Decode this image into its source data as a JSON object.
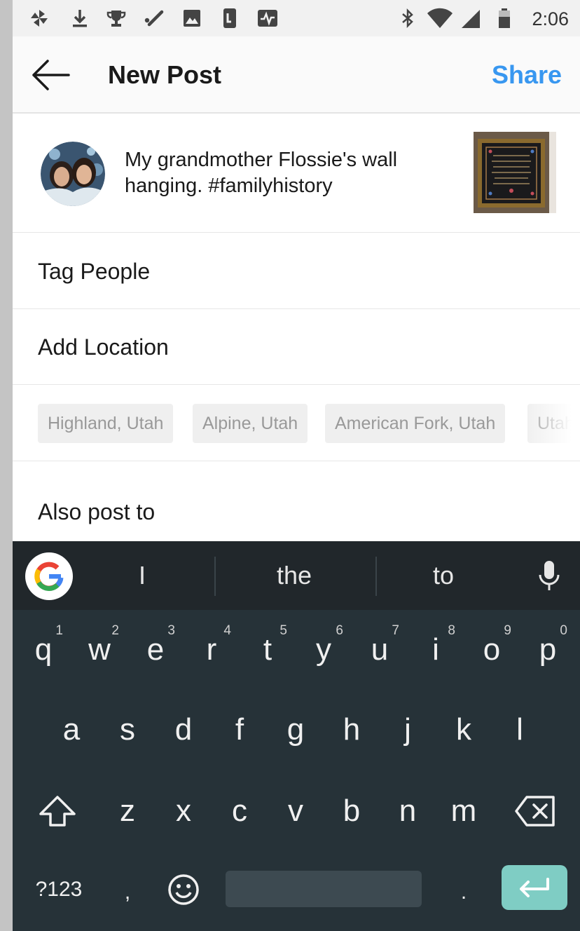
{
  "status_bar": {
    "time": "2:06",
    "left_icons": [
      "pinwheel-icon",
      "download-icon",
      "trophy-icon",
      "pen-icon",
      "image-icon",
      "phone-icon",
      "activity-icon"
    ],
    "right_icons": [
      "bluetooth-icon",
      "wifi-icon",
      "signal-icon",
      "battery-icon"
    ]
  },
  "toolbar": {
    "title": "New Post",
    "share_label": "Share",
    "back_icon": "arrow-left-icon"
  },
  "post": {
    "caption": "My grandmother Flossie's wall hanging. #familyhistory"
  },
  "options": {
    "tag_people": "Tag People",
    "add_location": "Add Location",
    "also_post_to": "Also post to"
  },
  "location_suggestions": [
    "Highland, Utah",
    "Alpine, Utah",
    "American Fork, Utah",
    "Utah"
  ],
  "keyboard": {
    "suggestions": [
      "I",
      "the",
      "to"
    ],
    "row1": [
      {
        "key": "q",
        "hint": "1"
      },
      {
        "key": "w",
        "hint": "2"
      },
      {
        "key": "e",
        "hint": "3"
      },
      {
        "key": "r",
        "hint": "4"
      },
      {
        "key": "t",
        "hint": "5"
      },
      {
        "key": "y",
        "hint": "6"
      },
      {
        "key": "u",
        "hint": "7"
      },
      {
        "key": "i",
        "hint": "8"
      },
      {
        "key": "o",
        "hint": "9"
      },
      {
        "key": "p",
        "hint": "0"
      }
    ],
    "row2": [
      "a",
      "s",
      "d",
      "f",
      "g",
      "h",
      "j",
      "k",
      "l"
    ],
    "row3": [
      "z",
      "x",
      "c",
      "v",
      "b",
      "n",
      "m"
    ],
    "symbols_label": "?123",
    "comma": ",",
    "period": "."
  },
  "colors": {
    "accent": "#3897f0",
    "keyboard_bg": "#263238",
    "enter_key": "#7fcdc4"
  }
}
